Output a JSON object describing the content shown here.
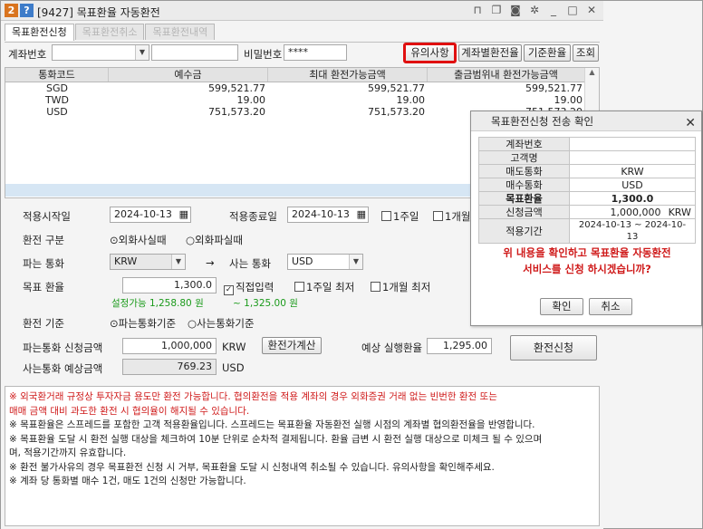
{
  "window": {
    "badge1": "2",
    "badge2": "?",
    "title": "[9427] 목표환율 자동환전",
    "icons": [
      "pin-icon",
      "copy-icon",
      "camera-icon",
      "gear-icon",
      "minimize-icon",
      "maximize-icon",
      "close-icon"
    ]
  },
  "tabs": [
    {
      "label": "목표환전신청",
      "active": true
    },
    {
      "label": "목표환전취소",
      "active": false
    },
    {
      "label": "목표환전내역",
      "active": false
    }
  ],
  "toprow": {
    "account_label": "계좌번호",
    "account_value": "",
    "account_name": "",
    "password_label": "비밀번호",
    "password_value": "****",
    "btn_notice": "유의사항",
    "btn_account_rate": "계좌별환전율",
    "btn_base_rate": "기준환율",
    "btn_query": "조회"
  },
  "grid": {
    "headers": [
      "통화코드",
      "예수금",
      "최대 환전가능금액",
      "출금범위내 환전가능금액"
    ],
    "rows": [
      [
        "SGD",
        "599,521.77",
        "599,521.77",
        "599,521.77"
      ],
      [
        "TWD",
        "19.00",
        "19.00",
        "19.00"
      ],
      [
        "USD",
        "751,573.20",
        "751,573.20",
        "751,573.20"
      ]
    ]
  },
  "form": {
    "start_label": "적용시작일",
    "start_date": "2024-10-13",
    "end_label": "적용종료일",
    "end_date": "2024-10-13",
    "period_1w": "1주일",
    "period_1m": "1개월",
    "type_label": "환전 구분",
    "type_buy": "외화사실때",
    "type_sell": "외화파실때",
    "sell_label": "파는 통화",
    "sell_currency": "KRW",
    "arrow": "→",
    "buy_label": "사는 통화",
    "buy_currency": "USD",
    "target_label": "목표 환율",
    "target_rate": "1,300.0",
    "direct_input": "직접입력",
    "max_1w": "1주일 최저",
    "max_1m": "1개월 최저",
    "range_text": "설정가능 1,258.80 원",
    "range_to": "~ 1,325.00 원",
    "basis_label": "환전 기준",
    "basis_sell": "파는통화기준",
    "basis_buy": "사는통화기준",
    "amount_label": "파는통화 신청금액",
    "amount_value": "1,000,000",
    "amount_unit": "KRW",
    "calc_btn": "환전가계산",
    "expected_rate_label": "예상 실행환율",
    "expected_rate": "1,295.00",
    "expected_amount_label": "사는통화 예상금액",
    "expected_amount": "769.23",
    "expected_unit": "USD",
    "apply_btn": "환전신청"
  },
  "notes": [
    {
      "text": "※ 외국환거래 규정상 투자자금 용도만 환전 가능합니다. 협의환전을 적용 계좌의 경우 외화증권 거래 없는 빈번한 환전 또는",
      "red": true
    },
    {
      "text": "    매매 금액 대비 과도한 환전 시 협의율이 해지될 수 있습니다.",
      "red": true
    },
    {
      "text": "※ 목표환율은 스프레드를 포함한 고객 적용환율입니다. 스프레드는 목표환율 자동환전 실행 시점의 계좌별 협의환전율을 반영합니다.",
      "red": false
    },
    {
      "text": "※ 목표환율 도달 시 환전 실행 대상을 체크하여 10분 단위로 순차적 결제됩니다. 환율 급변 시 환전 실행 대상으로 미체크 될 수 있으며",
      "red": false
    },
    {
      "text": "    며, 적용기간까지 유효합니다.",
      "red": false
    },
    {
      "text": "※ 환전 불가사유의 경우 목표환전 신청 시 거부, 목표환율 도달 시 신청내역 취소될 수 있습니다. 유의사항을 확인해주세요.",
      "red": false
    },
    {
      "text": "※ 계좌 당 통화별 매수 1건, 매도 1건의 신청만 가능합니다.",
      "red": false
    }
  ],
  "dialog": {
    "title": "목표환전신청 전송 확인",
    "rows": [
      {
        "key": "계좌번호",
        "value": ""
      },
      {
        "key": "고객명",
        "value": ""
      },
      {
        "key": "매도통화",
        "value": "KRW"
      },
      {
        "key": "매수통화",
        "value": "USD"
      },
      {
        "key": "목표환율",
        "value": "1,300.0",
        "bold": true
      },
      {
        "key": "신청금액",
        "value": "1,000,000",
        "unit": "KRW"
      },
      {
        "key": "적용기간",
        "value": "2024-10-13 ~ 2024-10-13"
      }
    ],
    "message1": "위 내용을 확인하고 목표환율 자동환전",
    "message2": "서비스를 신청 하시겠습니까?",
    "ok": "확인",
    "cancel": "취소"
  }
}
